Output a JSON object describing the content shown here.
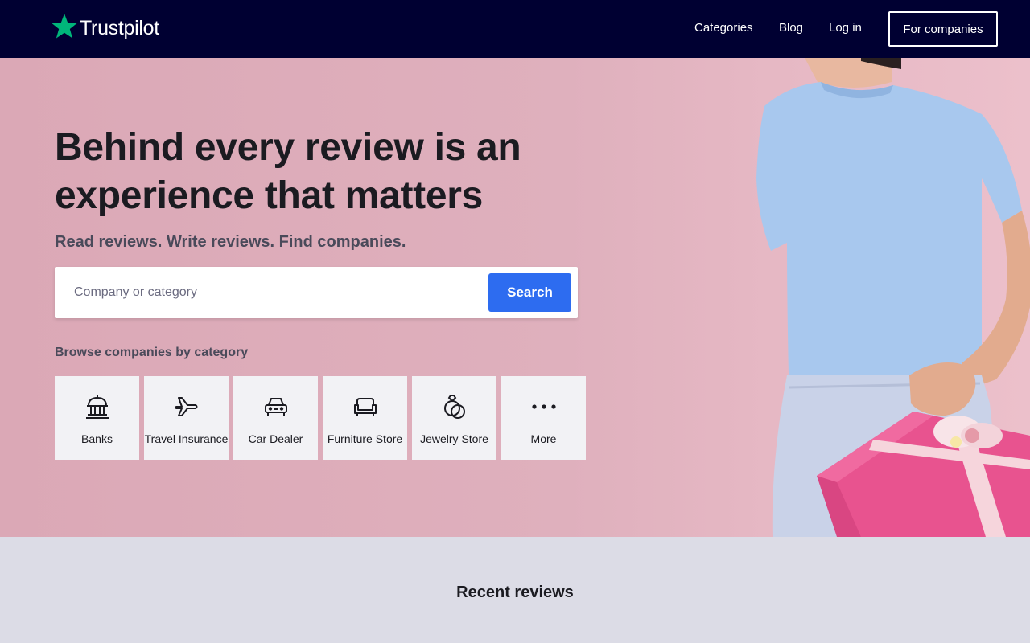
{
  "brand": {
    "name": "Trustpilot",
    "star_color": "#00b67a"
  },
  "nav": {
    "categories": "Categories",
    "blog": "Blog",
    "login": "Log in",
    "for_companies": "For companies"
  },
  "hero": {
    "headline": "Behind every review is an experience that matters",
    "subheadline": "Read reviews. Write reviews. Find companies.",
    "search": {
      "placeholder": "Company or category",
      "value": "",
      "button": "Search"
    },
    "browse_label": "Browse companies by category",
    "categories": [
      {
        "label": "Banks",
        "icon": "bank-icon"
      },
      {
        "label": "Travel Insurance",
        "icon": "airplane-icon"
      },
      {
        "label": "Car Dealer",
        "icon": "car-icon"
      },
      {
        "label": "Furniture Store",
        "icon": "sofa-icon"
      },
      {
        "label": "Jewelry Store",
        "icon": "rings-icon"
      },
      {
        "label": "More",
        "icon": "more-dots-icon"
      }
    ]
  },
  "recent_reviews": {
    "title": "Recent reviews"
  },
  "colors": {
    "nav_bg": "#000032",
    "hero_bg": "#dfb0bd",
    "accent": "#2d6cf0",
    "page_bg": "#dcdce6"
  }
}
